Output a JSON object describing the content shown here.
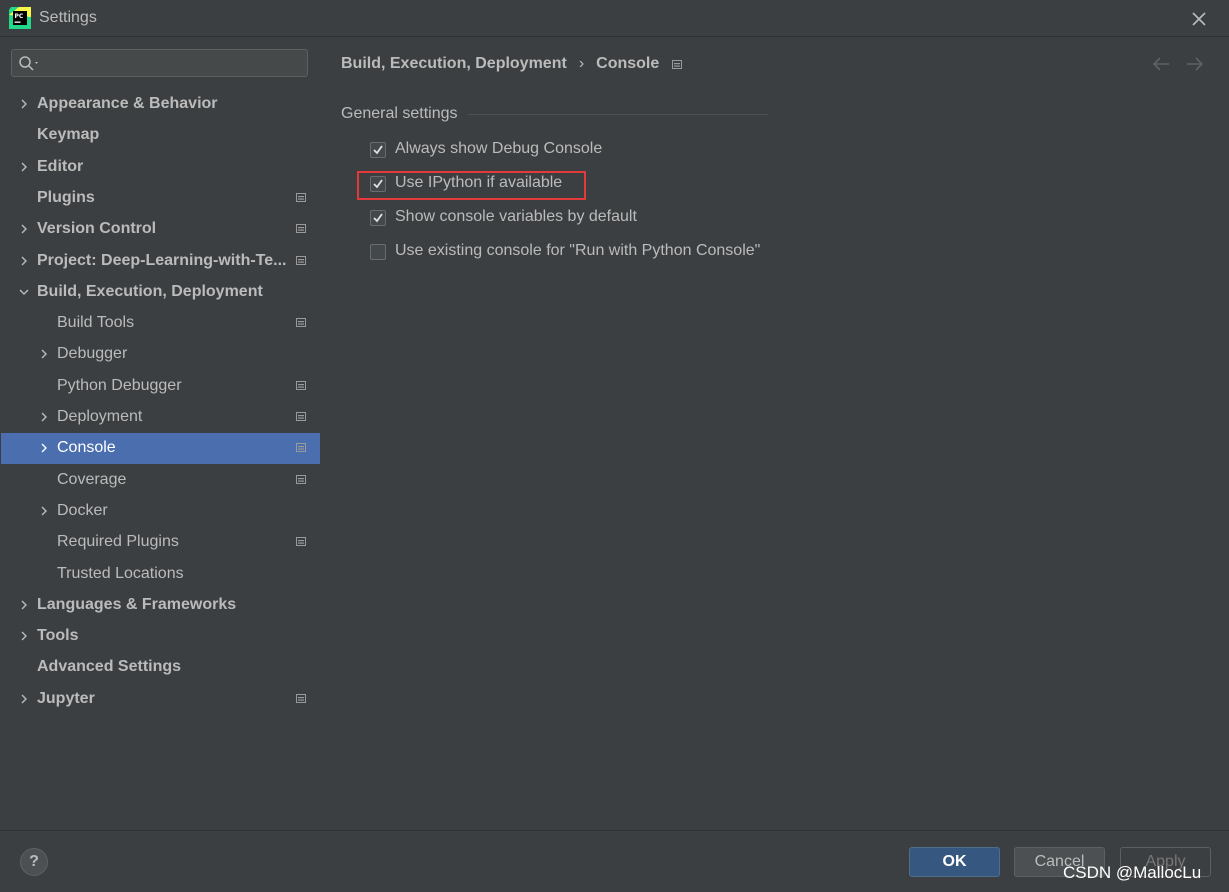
{
  "window": {
    "title": "Settings"
  },
  "search": {
    "placeholder": ""
  },
  "sidebar": {
    "items": [
      {
        "label": "Appearance & Behavior",
        "expandable": true,
        "expanded": false,
        "bold": true,
        "project_icon": false
      },
      {
        "label": "Keymap",
        "expandable": false,
        "bold": true,
        "project_icon": false
      },
      {
        "label": "Editor",
        "expandable": true,
        "expanded": false,
        "bold": true,
        "project_icon": false
      },
      {
        "label": "Plugins",
        "expandable": false,
        "bold": true,
        "project_icon": true
      },
      {
        "label": "Version Control",
        "expandable": true,
        "expanded": false,
        "bold": true,
        "project_icon": true
      },
      {
        "label": "Project: Deep-Learning-with-Te...",
        "expandable": true,
        "expanded": false,
        "bold": true,
        "project_icon": true
      },
      {
        "label": "Build, Execution, Deployment",
        "expandable": true,
        "expanded": true,
        "bold": true,
        "project_icon": false
      },
      {
        "label": "Build Tools",
        "expandable": false,
        "bold": false,
        "project_icon": true
      },
      {
        "label": "Debugger",
        "expandable": true,
        "expanded": false,
        "bold": false,
        "project_icon": false
      },
      {
        "label": "Python Debugger",
        "expandable": false,
        "bold": false,
        "project_icon": true
      },
      {
        "label": "Deployment",
        "expandable": true,
        "expanded": false,
        "bold": false,
        "project_icon": true
      },
      {
        "label": "Console",
        "expandable": true,
        "expanded": false,
        "bold": false,
        "project_icon": true,
        "selected": true
      },
      {
        "label": "Coverage",
        "expandable": false,
        "bold": false,
        "project_icon": true
      },
      {
        "label": "Docker",
        "expandable": true,
        "expanded": false,
        "bold": false,
        "project_icon": false
      },
      {
        "label": "Required Plugins",
        "expandable": false,
        "bold": false,
        "project_icon": true
      },
      {
        "label": "Trusted Locations",
        "expandable": false,
        "bold": false,
        "project_icon": false
      },
      {
        "label": "Languages & Frameworks",
        "expandable": true,
        "expanded": false,
        "bold": true,
        "project_icon": false
      },
      {
        "label": "Tools",
        "expandable": true,
        "expanded": false,
        "bold": true,
        "project_icon": false
      },
      {
        "label": "Advanced Settings",
        "expandable": false,
        "bold": true,
        "project_icon": false
      },
      {
        "label": "Jupyter",
        "expandable": true,
        "expanded": false,
        "bold": true,
        "project_icon": true
      }
    ]
  },
  "breadcrumb": {
    "parent": "Build, Execution, Deployment",
    "separator": "›",
    "current": "Console"
  },
  "main": {
    "group_title": "General settings",
    "options": [
      {
        "label": "Always show Debug Console",
        "checked": true
      },
      {
        "label": "Use IPython if available",
        "checked": true,
        "highlighted": true
      },
      {
        "label": "Show console variables by default",
        "checked": true
      },
      {
        "label": "Use existing console for \"Run with Python Console\"",
        "checked": false
      }
    ]
  },
  "buttons": {
    "help": "?",
    "ok": "OK",
    "cancel": "Cancel",
    "apply": "Apply"
  },
  "watermark": "CSDN @MallocLu",
  "colors": {
    "selection": "#4b6eaf",
    "highlight_box": "#e23a3a",
    "ok_button": "#365880"
  }
}
